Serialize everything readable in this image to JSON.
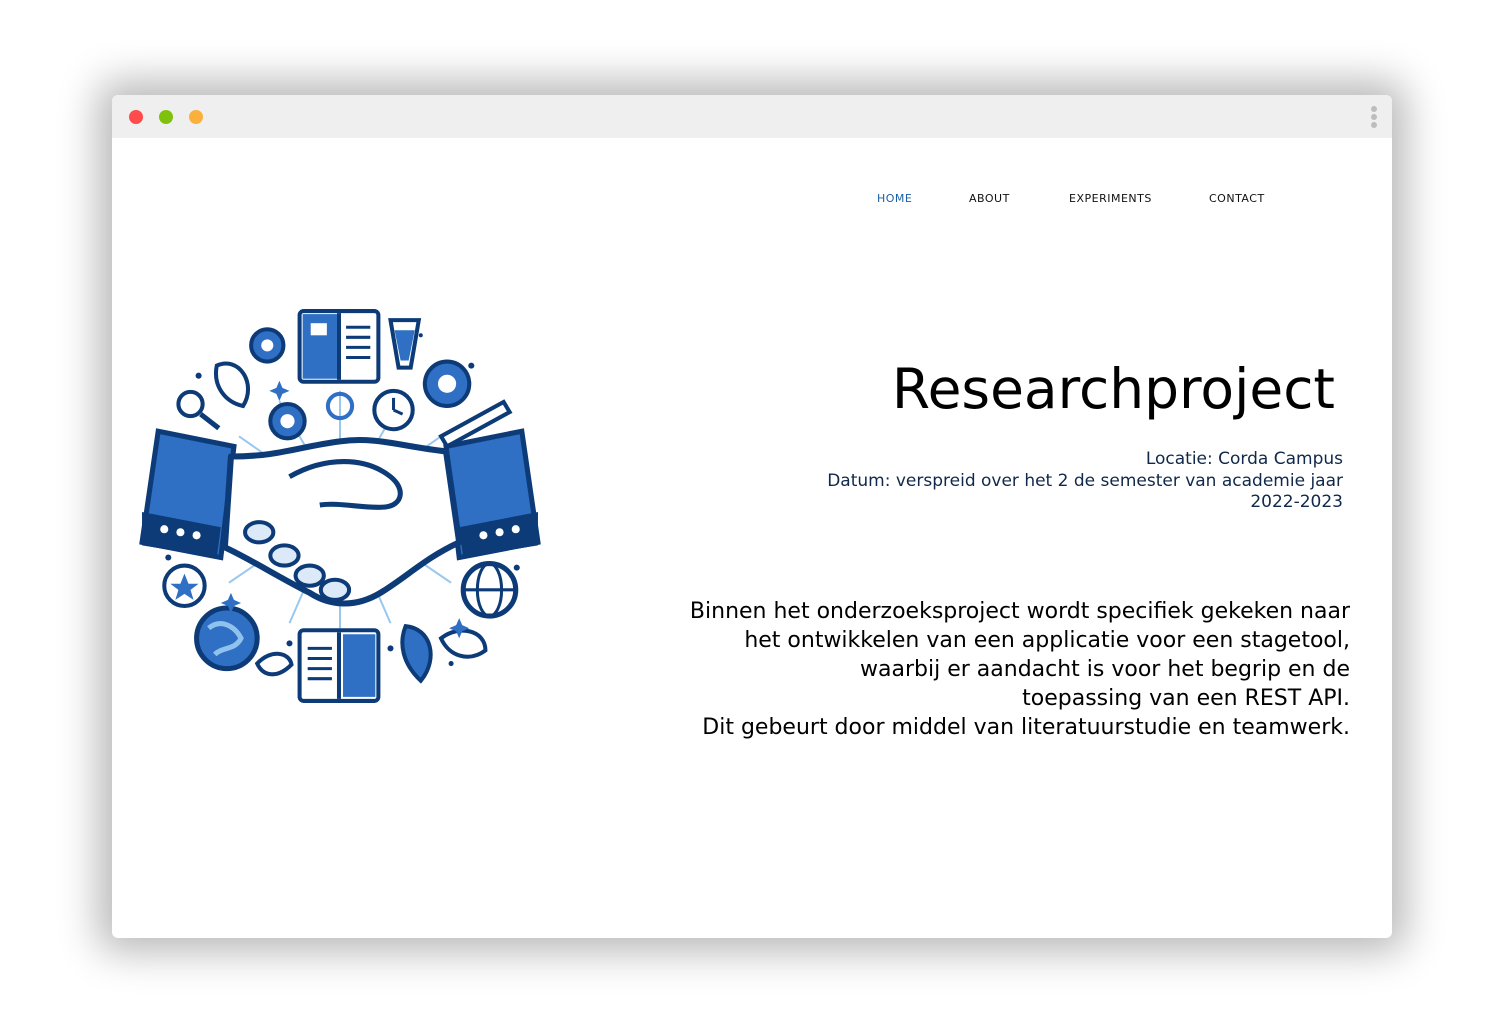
{
  "window": {
    "controls": [
      "close",
      "minimize",
      "maximize"
    ]
  },
  "nav": {
    "items": [
      {
        "label": "HOME",
        "active": true
      },
      {
        "label": "ABOUT",
        "active": false
      },
      {
        "label": "EXPERIMENTS",
        "active": false
      },
      {
        "label": "CONTACT",
        "active": false
      }
    ]
  },
  "hero": {
    "image_icon": "handshake-research-illustration-icon",
    "title": "Researchproject",
    "location": "Locatie: Corda Campus",
    "date_line1": "Datum: verspreid over het 2 de semester van academie jaar",
    "date_line2": "2022-2023",
    "description_lines": [
      "Binnen het onderzoeksproject wordt specifiek gekeken naar",
      "het ontwikkelen van een applicatie voor een stagetool,",
      "waarbij er aandacht is voor het begrip en de",
      "toepassing van een REST API.",
      "Dit gebeurt door middel van literatuurstudie en teamwerk."
    ]
  },
  "colors": {
    "accent": "#1d5fa6",
    "meta_text": "#10284a",
    "illustration_dark": "#0d3b78",
    "illustration_mid": "#2f6fc4",
    "illustration_light": "#8fc3ee"
  }
}
